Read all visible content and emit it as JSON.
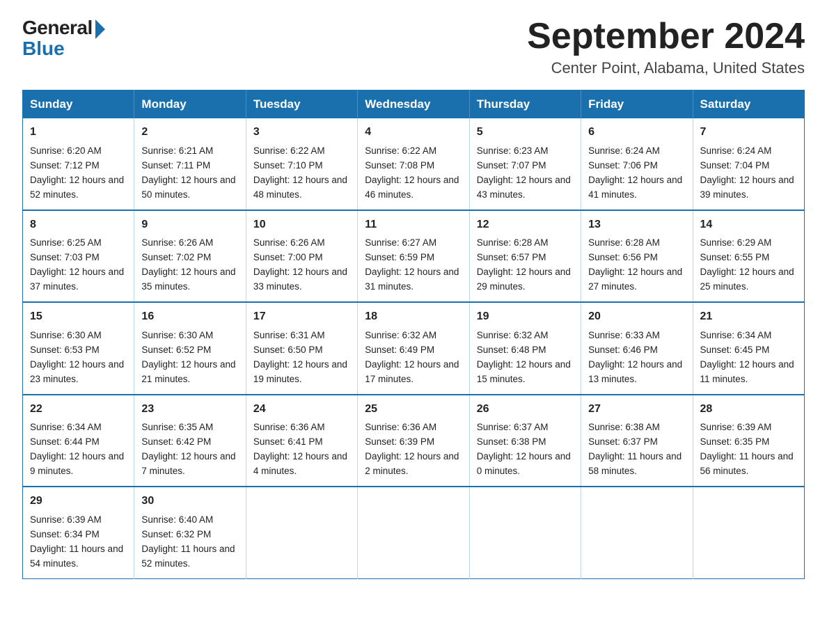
{
  "logo": {
    "general": "General",
    "blue": "Blue"
  },
  "title": "September 2024",
  "subtitle": "Center Point, Alabama, United States",
  "days_of_week": [
    "Sunday",
    "Monday",
    "Tuesday",
    "Wednesday",
    "Thursday",
    "Friday",
    "Saturday"
  ],
  "weeks": [
    [
      {
        "day": "1",
        "sunrise": "6:20 AM",
        "sunset": "7:12 PM",
        "daylight": "12 hours and 52 minutes."
      },
      {
        "day": "2",
        "sunrise": "6:21 AM",
        "sunset": "7:11 PM",
        "daylight": "12 hours and 50 minutes."
      },
      {
        "day": "3",
        "sunrise": "6:22 AM",
        "sunset": "7:10 PM",
        "daylight": "12 hours and 48 minutes."
      },
      {
        "day": "4",
        "sunrise": "6:22 AM",
        "sunset": "7:08 PM",
        "daylight": "12 hours and 46 minutes."
      },
      {
        "day": "5",
        "sunrise": "6:23 AM",
        "sunset": "7:07 PM",
        "daylight": "12 hours and 43 minutes."
      },
      {
        "day": "6",
        "sunrise": "6:24 AM",
        "sunset": "7:06 PM",
        "daylight": "12 hours and 41 minutes."
      },
      {
        "day": "7",
        "sunrise": "6:24 AM",
        "sunset": "7:04 PM",
        "daylight": "12 hours and 39 minutes."
      }
    ],
    [
      {
        "day": "8",
        "sunrise": "6:25 AM",
        "sunset": "7:03 PM",
        "daylight": "12 hours and 37 minutes."
      },
      {
        "day": "9",
        "sunrise": "6:26 AM",
        "sunset": "7:02 PM",
        "daylight": "12 hours and 35 minutes."
      },
      {
        "day": "10",
        "sunrise": "6:26 AM",
        "sunset": "7:00 PM",
        "daylight": "12 hours and 33 minutes."
      },
      {
        "day": "11",
        "sunrise": "6:27 AM",
        "sunset": "6:59 PM",
        "daylight": "12 hours and 31 minutes."
      },
      {
        "day": "12",
        "sunrise": "6:28 AM",
        "sunset": "6:57 PM",
        "daylight": "12 hours and 29 minutes."
      },
      {
        "day": "13",
        "sunrise": "6:28 AM",
        "sunset": "6:56 PM",
        "daylight": "12 hours and 27 minutes."
      },
      {
        "day": "14",
        "sunrise": "6:29 AM",
        "sunset": "6:55 PM",
        "daylight": "12 hours and 25 minutes."
      }
    ],
    [
      {
        "day": "15",
        "sunrise": "6:30 AM",
        "sunset": "6:53 PM",
        "daylight": "12 hours and 23 minutes."
      },
      {
        "day": "16",
        "sunrise": "6:30 AM",
        "sunset": "6:52 PM",
        "daylight": "12 hours and 21 minutes."
      },
      {
        "day": "17",
        "sunrise": "6:31 AM",
        "sunset": "6:50 PM",
        "daylight": "12 hours and 19 minutes."
      },
      {
        "day": "18",
        "sunrise": "6:32 AM",
        "sunset": "6:49 PM",
        "daylight": "12 hours and 17 minutes."
      },
      {
        "day": "19",
        "sunrise": "6:32 AM",
        "sunset": "6:48 PM",
        "daylight": "12 hours and 15 minutes."
      },
      {
        "day": "20",
        "sunrise": "6:33 AM",
        "sunset": "6:46 PM",
        "daylight": "12 hours and 13 minutes."
      },
      {
        "day": "21",
        "sunrise": "6:34 AM",
        "sunset": "6:45 PM",
        "daylight": "12 hours and 11 minutes."
      }
    ],
    [
      {
        "day": "22",
        "sunrise": "6:34 AM",
        "sunset": "6:44 PM",
        "daylight": "12 hours and 9 minutes."
      },
      {
        "day": "23",
        "sunrise": "6:35 AM",
        "sunset": "6:42 PM",
        "daylight": "12 hours and 7 minutes."
      },
      {
        "day": "24",
        "sunrise": "6:36 AM",
        "sunset": "6:41 PM",
        "daylight": "12 hours and 4 minutes."
      },
      {
        "day": "25",
        "sunrise": "6:36 AM",
        "sunset": "6:39 PM",
        "daylight": "12 hours and 2 minutes."
      },
      {
        "day": "26",
        "sunrise": "6:37 AM",
        "sunset": "6:38 PM",
        "daylight": "12 hours and 0 minutes."
      },
      {
        "day": "27",
        "sunrise": "6:38 AM",
        "sunset": "6:37 PM",
        "daylight": "11 hours and 58 minutes."
      },
      {
        "day": "28",
        "sunrise": "6:39 AM",
        "sunset": "6:35 PM",
        "daylight": "11 hours and 56 minutes."
      }
    ],
    [
      {
        "day": "29",
        "sunrise": "6:39 AM",
        "sunset": "6:34 PM",
        "daylight": "11 hours and 54 minutes."
      },
      {
        "day": "30",
        "sunrise": "6:40 AM",
        "sunset": "6:32 PM",
        "daylight": "11 hours and 52 minutes."
      },
      null,
      null,
      null,
      null,
      null
    ]
  ]
}
